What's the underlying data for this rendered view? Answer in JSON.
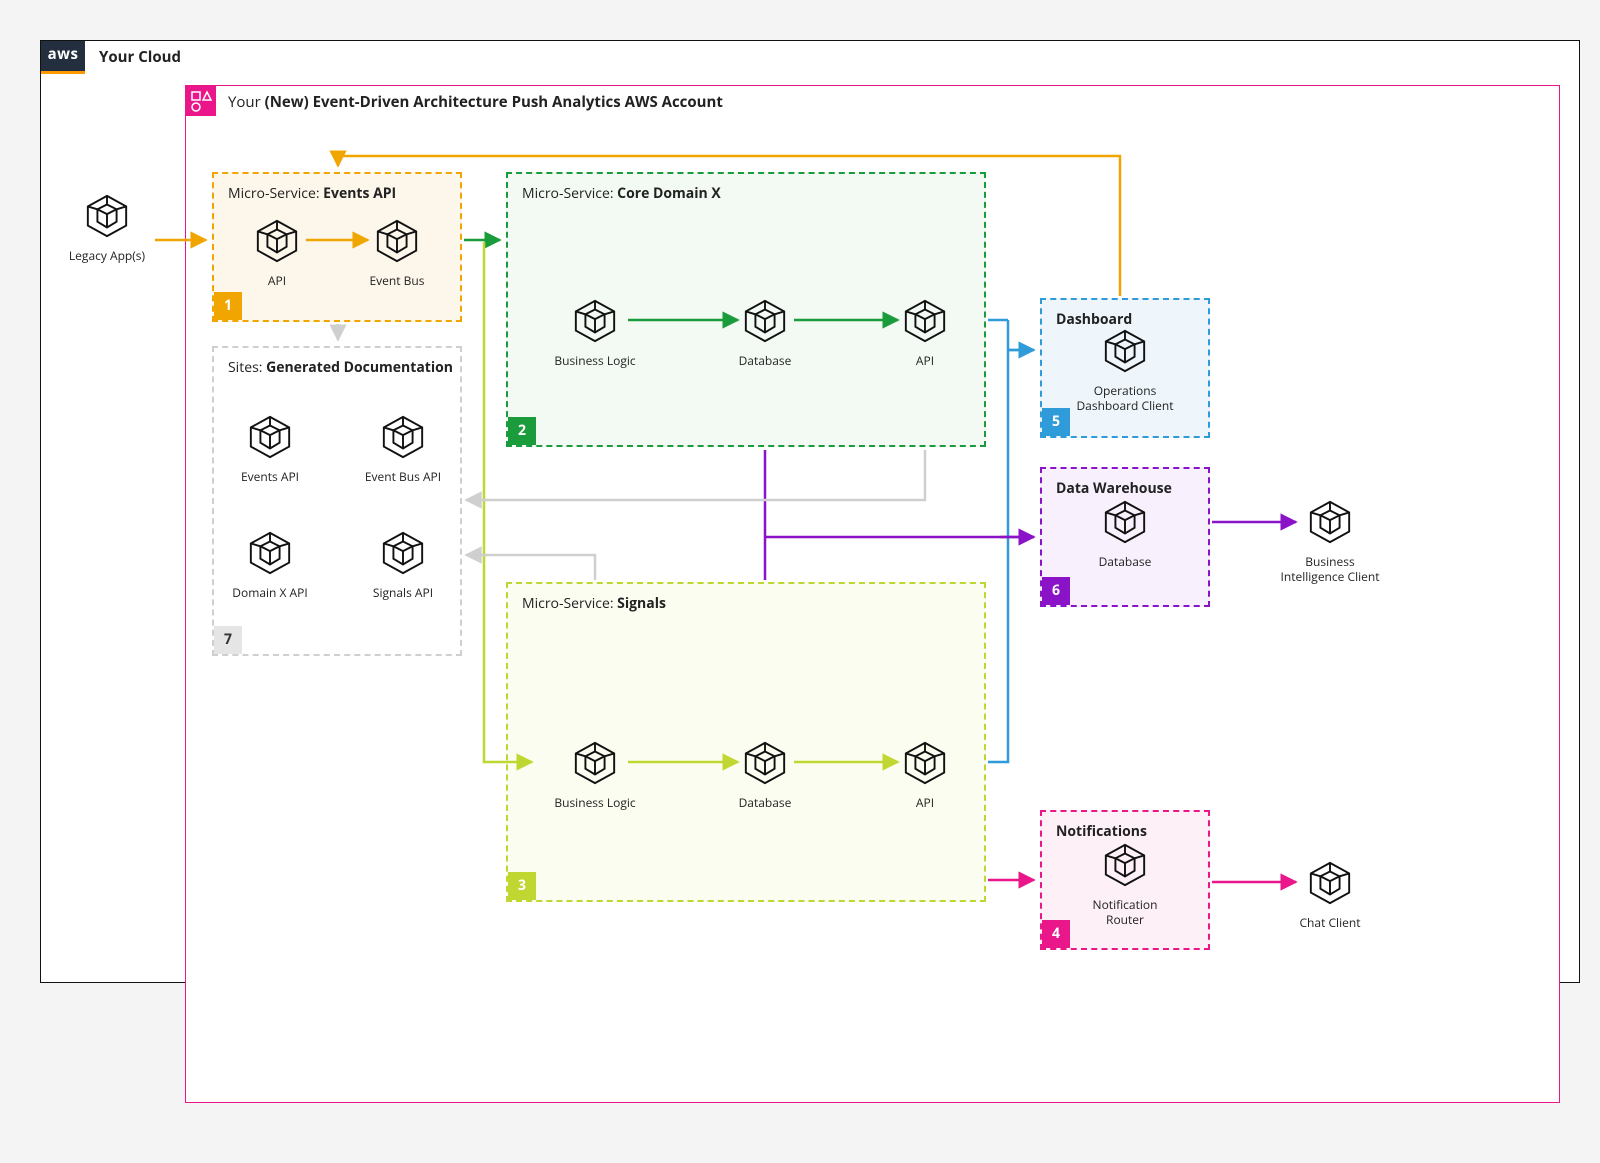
{
  "cloud_title": "Your Cloud",
  "account_title_prefix": "Your ",
  "account_title_bold": "(New) Event-Driven Architecture Push Analytics AWS Account",
  "legacy_label": "Legacy App(s)",
  "events_box": {
    "title_prefix": "Micro-Service: ",
    "title_bold": "Events API",
    "num": "1",
    "api_label": "API",
    "bus_label": "Event Bus"
  },
  "docs_box": {
    "title_prefix": "Sites: ",
    "title_bold": "Generated Documentation",
    "num": "7",
    "n1": "Events API",
    "n2": "Event Bus API",
    "n3": "Domain X API",
    "n4": "Signals API"
  },
  "core_box": {
    "title_prefix": "Micro-Service: ",
    "title_bold": "Core Domain X",
    "num": "2",
    "bl": "Business Logic",
    "db": "Database",
    "api": "API"
  },
  "signals_box": {
    "title_prefix": "Micro-Service: ",
    "title_bold": "Signals",
    "num": "3",
    "bl": "Business Logic",
    "db": "Database",
    "api": "API"
  },
  "dashboard_box": {
    "title": "Dashboard",
    "num": "5",
    "label": "Operations Dashboard Client"
  },
  "dw_box": {
    "title": "Data Warehouse",
    "num": "6",
    "label": "Database"
  },
  "notif_box": {
    "title": "Notifications",
    "num": "4",
    "label": "Notification Router"
  },
  "bi_label": "Business Intelligence Client",
  "chat_label": "Chat Client",
  "colors": {
    "amber": "#f0a500",
    "green": "#1a9c3c",
    "chart": "#bfd730",
    "blue": "#2f9bd8",
    "purple": "#8a12c7",
    "magenta": "#e9178a",
    "gray": "#cfcfcf"
  }
}
